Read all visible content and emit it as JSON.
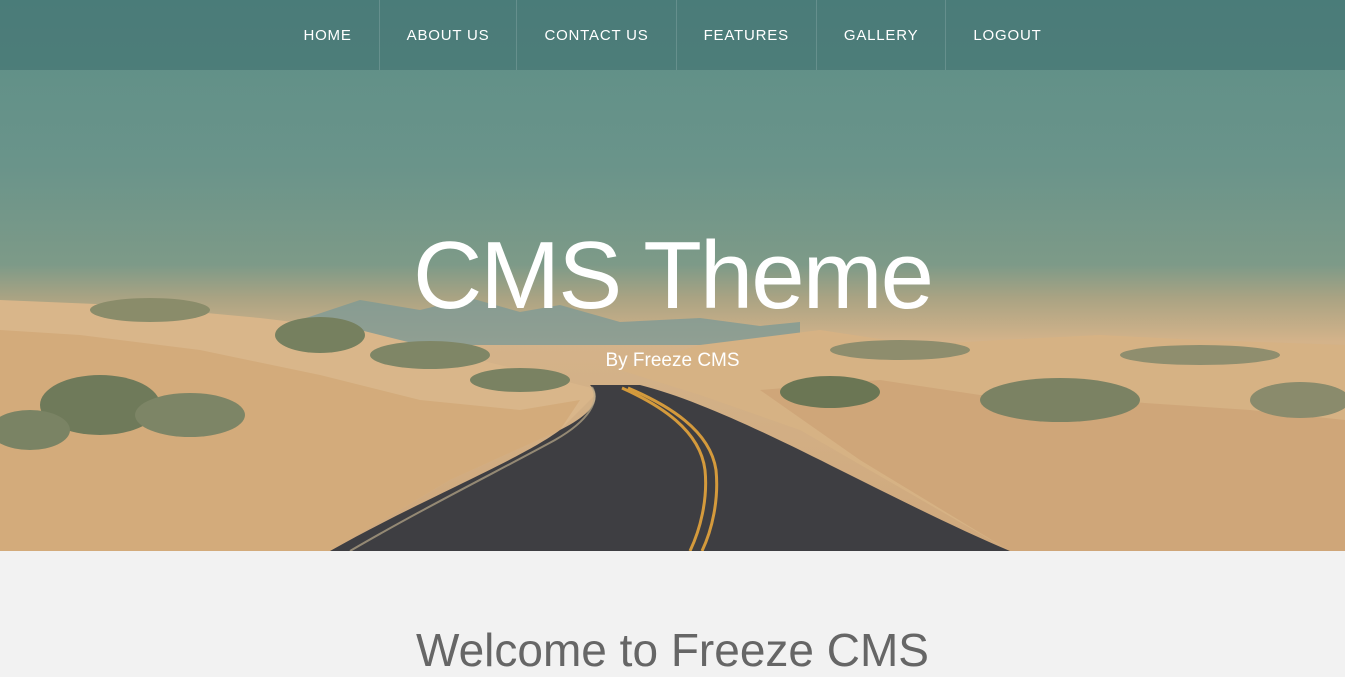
{
  "nav": {
    "items": [
      {
        "label": "HOME"
      },
      {
        "label": "ABOUT US"
      },
      {
        "label": "CONTACT US"
      },
      {
        "label": "FEATURES"
      },
      {
        "label": "GALLERY"
      },
      {
        "label": "LOGOUT"
      }
    ]
  },
  "hero": {
    "title": "CMS Theme",
    "subtitle": "By Freeze CMS"
  },
  "main": {
    "welcome_heading": "Welcome to Freeze CMS"
  }
}
